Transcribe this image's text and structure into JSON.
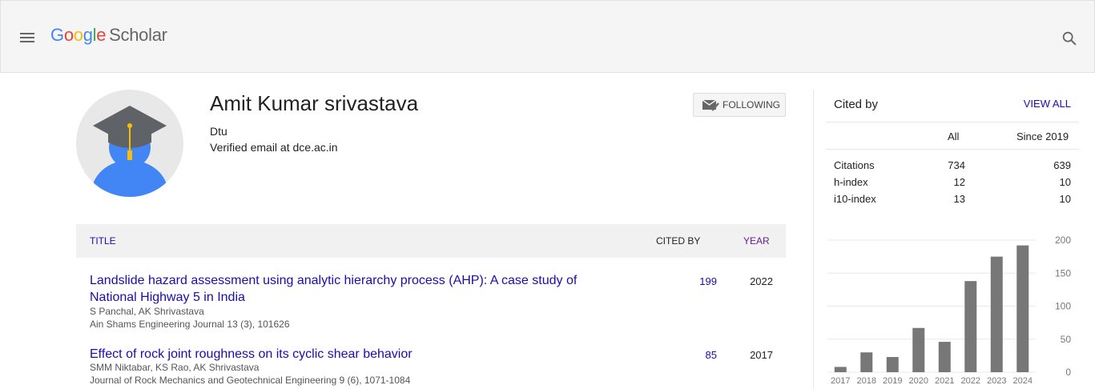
{
  "header": {
    "logo_letters": [
      {
        "ch": "G",
        "color": "#4285F4"
      },
      {
        "ch": "o",
        "color": "#EA4335"
      },
      {
        "ch": "o",
        "color": "#FBBC05"
      },
      {
        "ch": "g",
        "color": "#4285F4"
      },
      {
        "ch": "l",
        "color": "#34A853"
      },
      {
        "ch": "e",
        "color": "#EA4335"
      }
    ],
    "product": "Scholar"
  },
  "profile": {
    "name": "Amit Kumar srivastava",
    "affiliation": "Dtu",
    "email": "Verified email at dce.ac.in",
    "follow_label": "FOLLOWING"
  },
  "table": {
    "headers": {
      "title": "TITLE",
      "cited_by": "CITED BY",
      "year": "YEAR"
    },
    "rows": [
      {
        "title": "Landslide hazard assessment using analytic hierarchy process (AHP): A case study of National Highway 5 in India",
        "authors": "S Panchal, AK Shrivastava",
        "venue": "Ain Shams Engineering Journal 13 (3), 101626",
        "cited_by": "199",
        "year": "2022"
      },
      {
        "title": "Effect of rock joint roughness on its cyclic shear behavior",
        "authors": "SMM Niktabar, KS Rao, AK Shrivastava",
        "venue": "Journal of Rock Mechanics and Geotechnical Engineering 9 (6), 1071-1084",
        "cited_by": "85",
        "year": "2017"
      }
    ]
  },
  "cited_by": {
    "title": "Cited by",
    "view_all": "VIEW ALL",
    "col_all": "All",
    "col_since": "Since 2019",
    "metrics": [
      {
        "label": "Citations",
        "all": "734",
        "since": "639"
      },
      {
        "label": "h-index",
        "all": "12",
        "since": "10"
      },
      {
        "label": "i10-index",
        "all": "13",
        "since": "10"
      }
    ]
  },
  "chart_data": {
    "type": "bar",
    "categories": [
      "2017",
      "2018",
      "2019",
      "2020",
      "2021",
      "2022",
      "2023",
      "2024"
    ],
    "values": [
      8,
      30,
      23,
      67,
      46,
      138,
      175,
      192
    ],
    "ylim": [
      0,
      200
    ],
    "yticks": [
      "200",
      "150",
      "100",
      "50",
      "0"
    ],
    "bar_color": "#777777",
    "grid": true
  }
}
